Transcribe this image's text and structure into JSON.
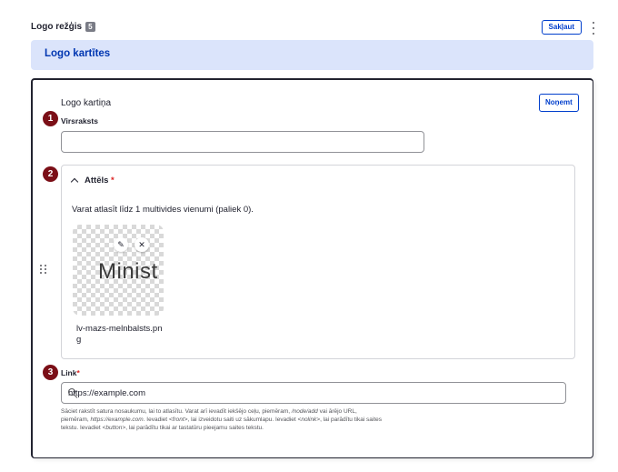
{
  "section": {
    "title": "Logo režģis",
    "count": "5",
    "collapse_label": "Sakļaut",
    "header_label": "Logo kartītes"
  },
  "card": {
    "label": "Logo kartiņa",
    "remove_label": "Noņemt",
    "badges": [
      "1",
      "2",
      "3"
    ],
    "heading_field": {
      "label": "Virsraksts",
      "value": ""
    },
    "image_field": {
      "label": "Attēls",
      "required_mark": "*",
      "description": "Varat atlasīt līdz 1 multivides vienumi (paliek 0).",
      "thumb_text": "Minist",
      "file_name": "lv-mazs-melnbalsts.png",
      "edit_icon": "pencil-icon",
      "remove_icon": "close-icon"
    },
    "link_field": {
      "label": "Link",
      "required_mark": "*",
      "value": "https://example.com",
      "help": {
        "p1": "Sāciet rakstīt satura nosaukumu, lai to atlasītu. Varat arī ievadīt iekšējo ceļu, piemēram, ",
        "node_add": "/node/add",
        "p2": " vai ārējo URL, piemēram, ",
        "example": "https://example.com",
        "p3": ". Ievadiet ",
        "front": "<front>",
        "p4": ", lai izveidotu saiti uz sākumlapu. Ievadiet ",
        "nolink": "<nolink>",
        "p5": ", lai parādītu tikai saites tekstu. Ievadiet ",
        "button": "<button>",
        "p6": ", lai parādītu tikai ar tastatūru pieejamu saites tekstu."
      }
    }
  },
  "colors": {
    "accent": "#003ecc",
    "header_bg": "#dbe4fb",
    "badge": "#7b0f17",
    "required": "#dc2323"
  }
}
